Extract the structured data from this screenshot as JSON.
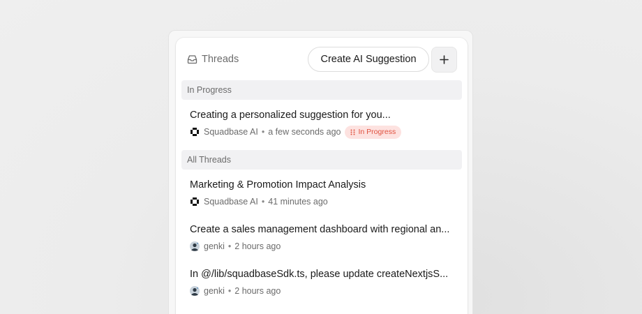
{
  "header": {
    "title": "Threads",
    "title_icon": "inbox-icon",
    "create_button_label": "Create AI Suggestion",
    "add_button_icon": "plus-icon"
  },
  "sections": {
    "in_progress": {
      "label": "In Progress",
      "items": [
        {
          "title": "Creating a personalized suggestion for you...",
          "author": "Squadbase AI",
          "author_icon": "squadbase-logo-icon",
          "separator": "•",
          "time": "a few seconds ago",
          "badge": "In Progress",
          "badge_icon": "spinner-dots-icon"
        }
      ]
    },
    "all_threads": {
      "label": "All Threads",
      "items": [
        {
          "title": "Marketing & Promotion Impact Analysis",
          "author": "Squadbase AI",
          "author_icon": "squadbase-logo-icon",
          "separator": "•",
          "time": "41 minutes ago"
        },
        {
          "title": "Create a sales management dashboard with regional an...",
          "author": "genki",
          "author_icon": "user-avatar-icon",
          "separator": "•",
          "time": "2 hours ago"
        },
        {
          "title": "In @/lib/squadbaseSdk.ts, please update createNextjsS...",
          "author": "genki",
          "author_icon": "user-avatar-icon",
          "separator": "•",
          "time": "2 hours ago"
        }
      ]
    }
  },
  "colors": {
    "badge_bg": "#fde2e0",
    "badge_text": "#e0513f",
    "section_bg": "#f1f1f3",
    "muted_text": "#6b6b6b"
  }
}
